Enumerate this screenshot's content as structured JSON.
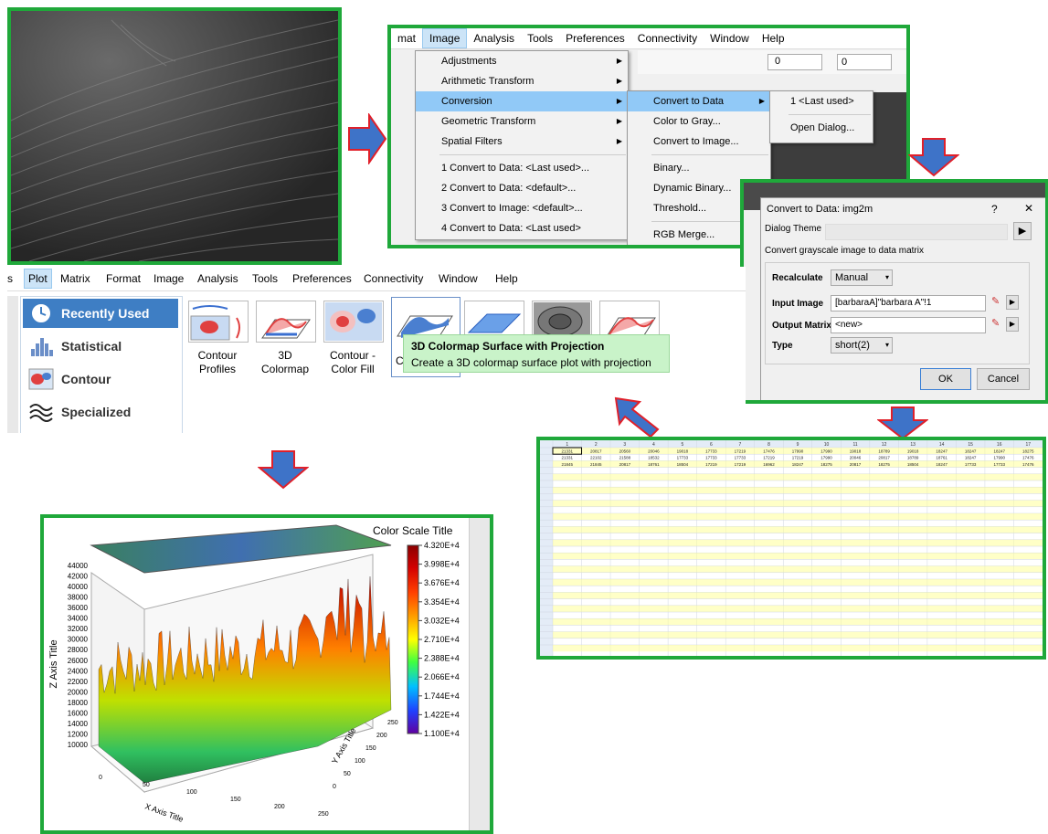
{
  "menu_panel": {
    "menubar": [
      "mat",
      "Image",
      "Analysis",
      "Tools",
      "Preferences",
      "Connectivity",
      "Window",
      "Help"
    ],
    "image_menu": {
      "items": [
        "Adjustments",
        "Arithmetic Transform",
        "Conversion",
        "Geometric Transform",
        "Spatial Filters",
        "1 Convert to Data: <Last used>...",
        "2 Convert to Data: <default>...",
        "3 Convert to Image: <default>...",
        "4 Convert to Data: <Last used>"
      ]
    },
    "conversion_menu": {
      "items": [
        "Convert to Data",
        "Color to Gray...",
        "Convert to Image...",
        "Binary...",
        "Dynamic Binary...",
        "Threshold...",
        "RGB Merge..."
      ]
    },
    "convert_to_data_menu": {
      "items": [
        "1 <Last used>",
        "Open Dialog..."
      ]
    },
    "toolbar_values": {
      "combo1": "0",
      "combo2": "0"
    }
  },
  "dialog": {
    "title": "Convert to Data: img2m",
    "help": "?",
    "close": "✕",
    "dialog_theme_label": "Dialog Theme",
    "description": "Convert grayscale image to data matrix",
    "recalculate_label": "Recalculate",
    "recalculate_value": "Manual",
    "input_image_label": "Input Image",
    "input_image_value": "[barbaraA]\"barbara A\"!1",
    "output_matrix_label": "Output Matrix",
    "output_matrix_value": "<new>",
    "type_label": "Type",
    "type_value": "short(2)",
    "ok": "OK",
    "cancel": "Cancel"
  },
  "plot_panel": {
    "menubar": [
      "s",
      "Plot",
      "Matrix",
      "Format",
      "Image",
      "Analysis",
      "Tools",
      "Preferences",
      "Connectivity",
      "Window",
      "Help"
    ],
    "sidebar": [
      "Recently Used",
      "Statistical",
      "Contour",
      "Specialized"
    ],
    "thumbs": [
      {
        "label1": "Contour",
        "label2": "Profiles"
      },
      {
        "label1": "3D",
        "label2": "Colormap"
      },
      {
        "label1": "Contour -",
        "label2": "Color Fill"
      },
      {
        "label1": "C",
        "label2": ""
      }
    ],
    "tooltip_title": "3D Colormap Surface with Projection",
    "tooltip_desc": "Create a 3D colormap surface plot with projection"
  },
  "surface_plot": {
    "color_scale_title": "Color Scale Title",
    "colorbar_labels": [
      "4.320E+4",
      "3.998E+4",
      "3.676E+4",
      "3.354E+4",
      "3.032E+4",
      "2.710E+4",
      "2.388E+4",
      "2.066E+4",
      "1.744E+4",
      "1.422E+4",
      "1.100E+4"
    ],
    "z_axis_label": "Z Axis Title",
    "x_axis_label": "X Axis Title",
    "y_axis_label": "Y Axis Title",
    "z_ticks": [
      "44000",
      "42000",
      "40000",
      "38000",
      "36000",
      "34000",
      "32000",
      "30000",
      "28000",
      "26000",
      "24000",
      "22000",
      "20000",
      "18000",
      "16000",
      "14000",
      "12000",
      "10000"
    ],
    "x_ticks": [
      "0",
      "50",
      "100",
      "150",
      "200",
      "250"
    ],
    "y_ticks": [
      "0",
      "50",
      "100",
      "150",
      "200",
      "250"
    ]
  },
  "spreadsheet": {
    "col_headers": [
      "1",
      "2",
      "3",
      "4",
      "5",
      "6",
      "7",
      "8",
      "9",
      "10",
      "11",
      "12",
      "13",
      "14",
      "15",
      "16",
      "17"
    ],
    "rows": [
      [
        "21331",
        "20817",
        "20560",
        "20046",
        "19018",
        "17733",
        "17219",
        "17476",
        "17990",
        "17990",
        "19018",
        "18789",
        "19018",
        "18247",
        "18247",
        "18247",
        "18275"
      ],
      [
        "21331",
        "22102",
        "21588",
        "18532",
        "17733",
        "17733",
        "17733",
        "17219",
        "17219",
        "17990",
        "20046",
        "20817",
        "18789",
        "18761",
        "18247",
        "17990",
        "17476"
      ],
      [
        "21845",
        "21845",
        "20817",
        "18761",
        "18504",
        "17219",
        "17219",
        "16962",
        "18247",
        "18275",
        "20817",
        "18275",
        "18504",
        "18247",
        "17733",
        "17733",
        "17476"
      ]
    ]
  },
  "colors": {
    "frame": "#1fa83a",
    "arrow": "#3e73c8",
    "arrow_outline": "#e0202a",
    "selection": "#91c9f7",
    "sidebar_sel": "#3e7ec4",
    "tooltip": "#c9f3c9",
    "cell_yellow": "#ffff99"
  }
}
